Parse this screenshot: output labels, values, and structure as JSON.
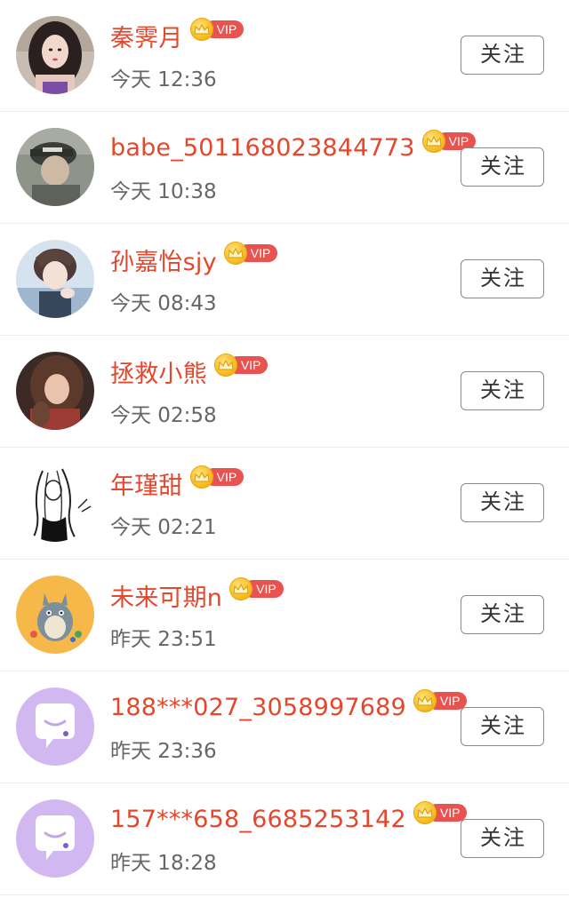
{
  "vip_label": "VIP",
  "colors": {
    "name": "#e5472c",
    "vip_badge": "#e8524f",
    "crown": "#f5b514",
    "time": "#666666"
  },
  "users": [
    {
      "name": "秦霁月",
      "time": "今天 12:36",
      "follow_label": "关注",
      "avatar": "photo-woman-long-hair"
    },
    {
      "name": "babe_501168023844773",
      "time": "今天 10:38",
      "follow_label": "关注",
      "avatar": "photo-man-cap"
    },
    {
      "name": "孙嘉怡sjy",
      "time": "今天 08:43",
      "follow_label": "关注",
      "avatar": "anime-boy"
    },
    {
      "name": "拯救小熊",
      "time": "今天 02:58",
      "follow_label": "关注",
      "avatar": "photo-woman-curly-hair"
    },
    {
      "name": "年瑾甜",
      "time": "今天 02:21",
      "follow_label": "关注",
      "avatar": "sketch-woman"
    },
    {
      "name": "未来可期n",
      "time": "昨天 23:51",
      "follow_label": "关注",
      "avatar": "totoro"
    },
    {
      "name": "188***027_3058997689",
      "time": "昨天 23:36",
      "follow_label": "关注",
      "avatar": "default-chat-bubble"
    },
    {
      "name": "157***658_6685253142",
      "time": "昨天 18:28",
      "follow_label": "关注",
      "avatar": "default-chat-bubble"
    }
  ]
}
